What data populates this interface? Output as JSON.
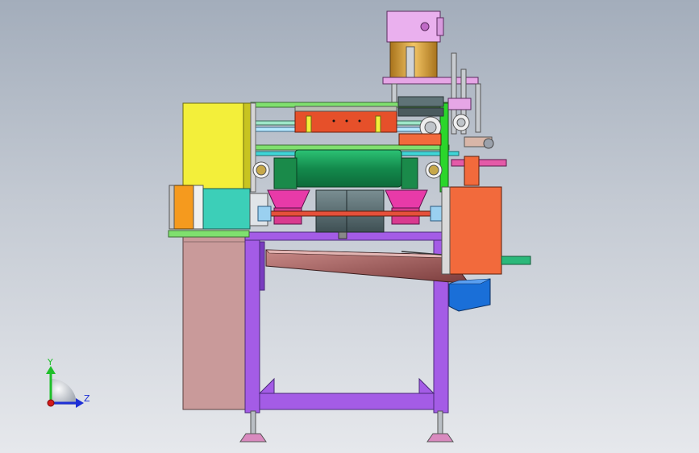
{
  "viewport": {
    "background_top": "#a3adbb",
    "background_bottom": "#e6e8ec"
  },
  "triad": {
    "y_label": "Y",
    "z_label": "Z",
    "y_color": "#1fbf2a",
    "z_color": "#1d2fd6",
    "x_color": "#d41a1a"
  },
  "colors": {
    "frame_purple": "#a45ce6",
    "side_panel": "#c99a9a",
    "yellow_cover": "#f3ef3a",
    "green_roller": "#1fa35e",
    "orange_box": "#f26a3c",
    "motor_orange": "#f59a1e",
    "motor_pink": "#eab0ee",
    "motor_gold": "#e0a43a",
    "teal_block": "#3ccfb8",
    "magenta_cup": "#e83aa8",
    "blue_block": "#1a6fd8",
    "gray_gearbox": "#5f7377",
    "chute_brown": "#7a3b3b"
  }
}
